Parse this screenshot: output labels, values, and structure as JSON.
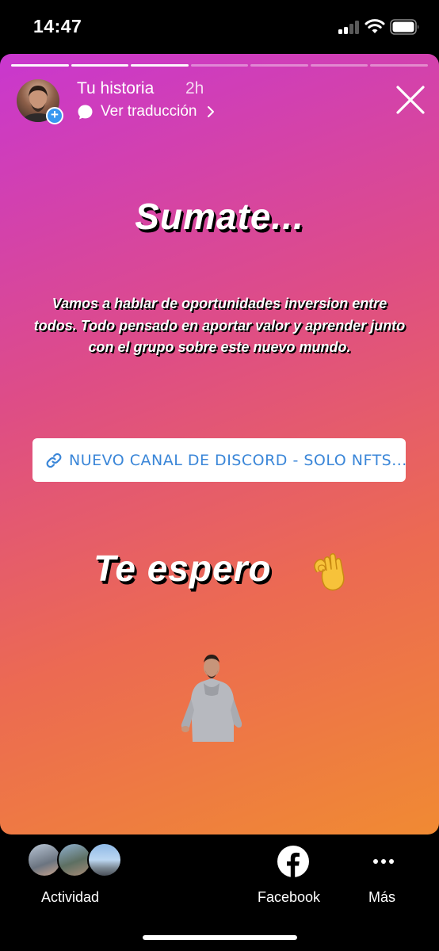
{
  "status_bar": {
    "time": "14:47"
  },
  "story": {
    "progress": {
      "total_segments": 7,
      "current_segment": 3
    },
    "header": {
      "username": "Tu historia",
      "age": "2h",
      "translate_label": "Ver traducción",
      "avatar_add_symbol": "+"
    },
    "headline": "Sumate...",
    "body": "Vamos a hablar de oportunidades inversion entre todos. Todo pensado en aportar valor y aprender junto con el grupo sobre este nuevo mundo.",
    "link_sticker": {
      "label": "NUEVO CANAL DE DISCORD - SOLO NFTS..."
    },
    "closing": "Te espero",
    "emoji": "ok-hand",
    "gradient_colors": [
      "#c937cf",
      "#de4d86",
      "#ec6a52",
      "#f08a33"
    ]
  },
  "bottom_bar": {
    "activity_label": "Actividad",
    "facebook_label": "Facebook",
    "more_label": "Más"
  },
  "icons": {
    "close": "close-icon",
    "translate": "translate-bubble-icon",
    "link": "link-icon",
    "facebook": "facebook-icon",
    "more": "more-dots-icon"
  }
}
